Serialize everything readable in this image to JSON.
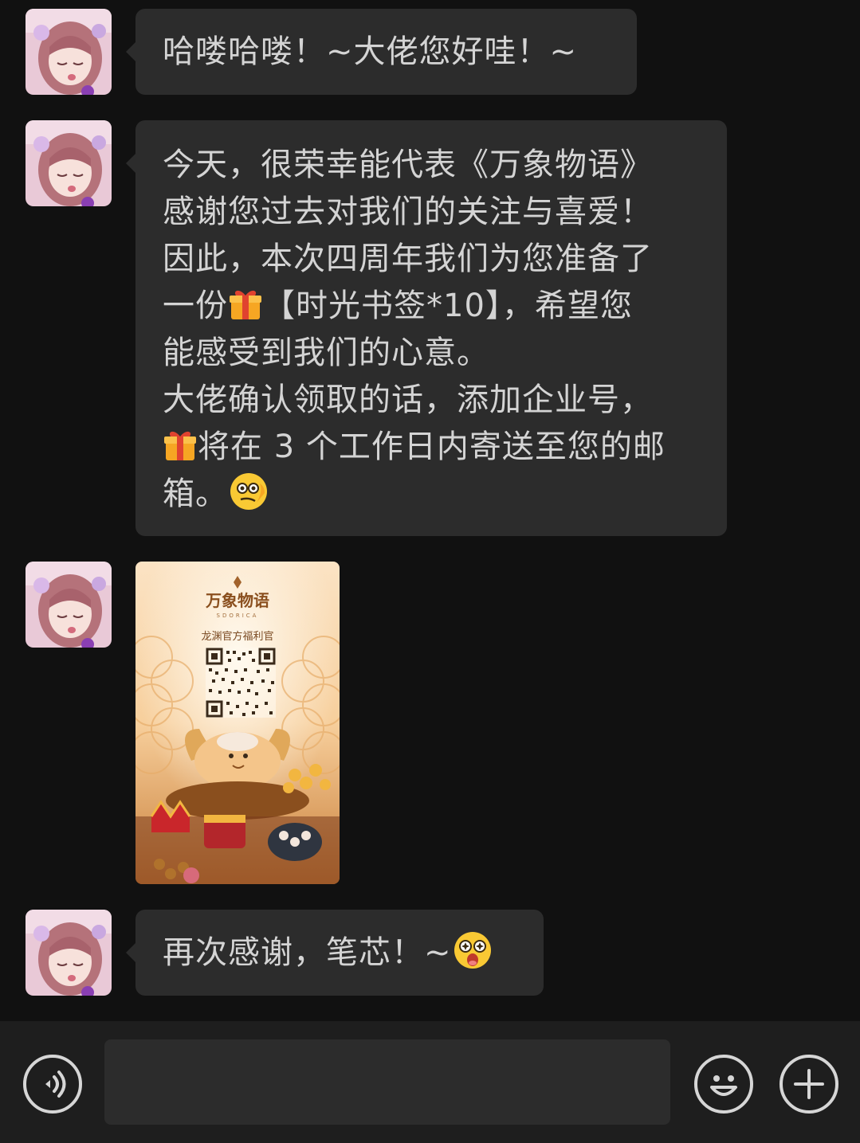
{
  "messages": [
    {
      "type": "text",
      "lines": [
        "哈喽哈喽！~大佬您好哇！~"
      ]
    },
    {
      "type": "text",
      "lines": [
        "今天，很荣幸能代表《万象物语》",
        "感谢您过去对我们的关注与喜爱！",
        "因此，本次四周年我们为您准备了"
      ],
      "line4_pre": "一份",
      "line4_post": "【时光书签*10】，希望您",
      "line5": "能感受到我们的心意。",
      "line6": "大佬确认领取的话，添加企业号，",
      "line7_post": "将在 3 个工作日内寄送至您的邮",
      "line8": "箱。"
    },
    {
      "type": "image",
      "brand": "万象物语",
      "brand_sub": "SDORICA",
      "caption": "龙渊官方福利官"
    },
    {
      "type": "text",
      "lines": [
        "再次感谢，笔芯！~"
      ]
    }
  ],
  "icons": {
    "gift": "wrapped-gift-emoji",
    "thinking": "smirk-thinking-emoji",
    "starstruck": "star-eyes-emoji",
    "voice": "voice-input-icon",
    "sticker": "emoji-icon",
    "plus": "plus-icon"
  },
  "input": {
    "placeholder": ""
  },
  "colors": {
    "background": "#111111",
    "bubble": "#2c2c2c",
    "bar": "#1e1e1e",
    "text": "#d4d4d4"
  }
}
